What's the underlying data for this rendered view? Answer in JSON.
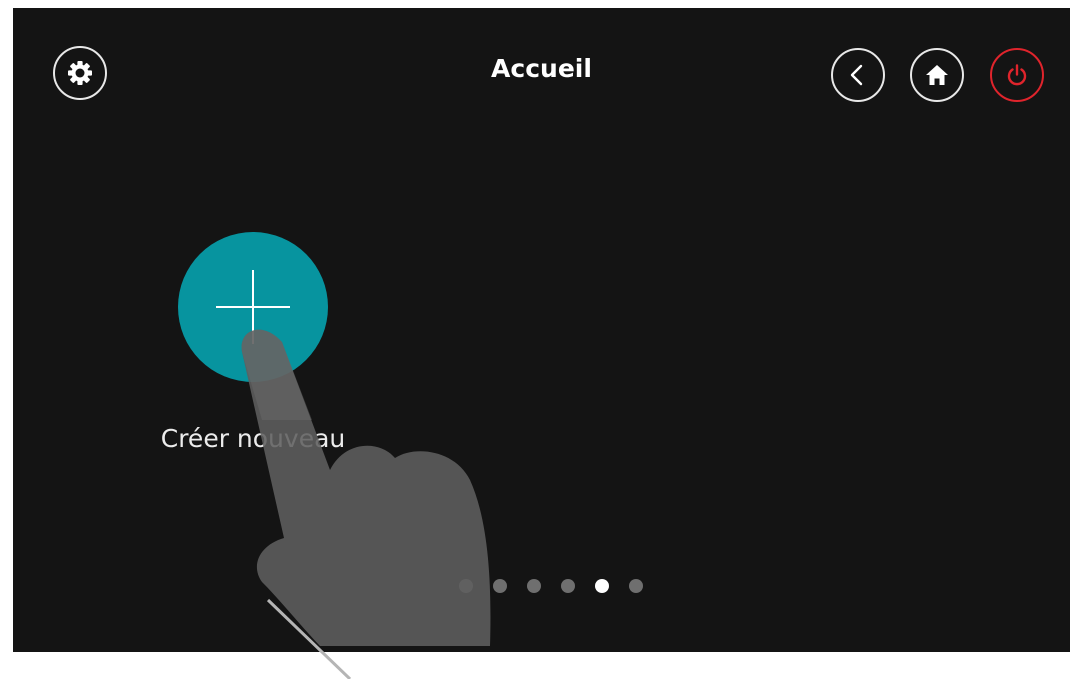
{
  "header": {
    "title": "Accueil",
    "settings_icon": "gear-icon",
    "back_icon": "chevron-left-icon",
    "home_icon": "home-icon",
    "power_icon": "power-icon"
  },
  "main": {
    "create_button_icon": "plus-icon",
    "create_label": "Créer nouveau"
  },
  "pager": {
    "count": 6,
    "active_index": 4
  },
  "colors": {
    "background": "#141414",
    "accent": "#07949f",
    "power": "#e0242c"
  }
}
